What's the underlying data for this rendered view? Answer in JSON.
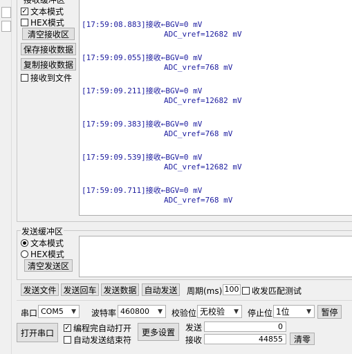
{
  "receive": {
    "group_title": "接收缓冲区",
    "text_mode": "文本模式",
    "hex_mode": "HEX模式",
    "clear_btn": "清空接收区",
    "save_btn": "保存接收数据",
    "copy_btn": "复制接收数据",
    "to_file": "接收到文件",
    "log": [
      {
        "time": "[17:59:08.883]接收←BGV=0 mV",
        "value": "ADC_vref=12682 mV"
      },
      {
        "time": "[17:59:09.055]接收←BGV=0 mV",
        "value": "ADC_vref=768 mV"
      },
      {
        "time": "[17:59:09.211]接收←BGV=0 mV",
        "value": "ADC_vref=12682 mV"
      },
      {
        "time": "[17:59:09.383]接收←BGV=0 mV",
        "value": "ADC_vref=768 mV"
      },
      {
        "time": "[17:59:09.539]接收←BGV=0 mV",
        "value": "ADC_vref=12682 mV"
      },
      {
        "time": "[17:59:09.711]接收←BGV=0 mV",
        "value": "ADC_vref=768 mV"
      }
    ]
  },
  "send": {
    "group_title": "发送缓冲区",
    "text_mode": "文本模式",
    "hex_mode": "HEX模式",
    "clear_btn": "清空发送区"
  },
  "actions": {
    "send_file": "发送文件",
    "send_back": "发送回车",
    "send_data": "发送数据",
    "auto_send": "自动发送",
    "period_label": "周期(ms)",
    "period_value": "100",
    "match_test": "收发匹配测试"
  },
  "serial": {
    "port_label": "串口",
    "port_value": "COM5",
    "baud_label": "波特率",
    "baud_value": "460800",
    "parity_label": "校验位",
    "parity_value": "无校验",
    "stop_label": "停止位",
    "stop_value": "1位",
    "pause_btn": "暂停",
    "open_btn": "打开串口",
    "auto_open": "编程完自动打开",
    "auto_end": "自动发送结束符",
    "more_settings": "更多设置",
    "sent_label": "发送",
    "sent_count": "0",
    "recv_label": "接收",
    "recv_count": "44855",
    "clear_count_btn": "清零"
  }
}
